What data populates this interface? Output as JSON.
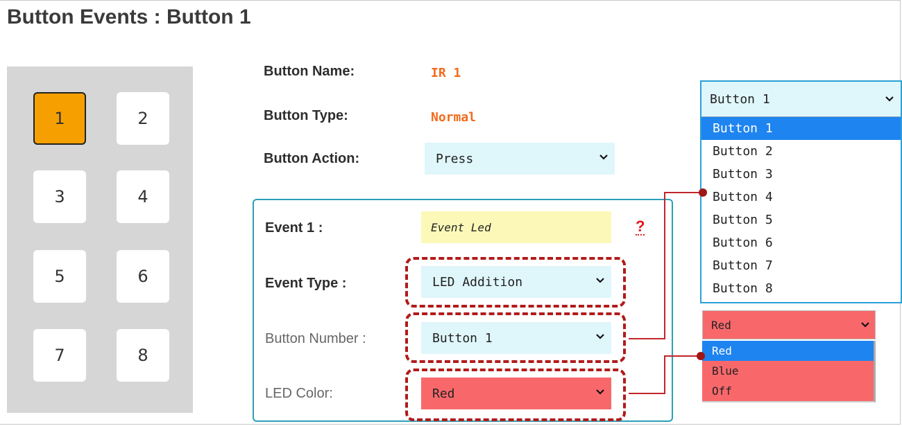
{
  "page_title": "Button Events : Button 1",
  "keypad": {
    "keys": [
      "1",
      "2",
      "3",
      "4",
      "5",
      "6",
      "7",
      "8"
    ],
    "active": "1"
  },
  "button_info": {
    "name_label": "Button Name:",
    "name_value": "IR 1",
    "type_label": "Button Type:",
    "type_value": "Normal",
    "action_label": "Button Action:",
    "action_value": "Press"
  },
  "event": {
    "label": "Event 1 :",
    "name_value": "Event Led",
    "help_text": "?",
    "type_label": "Event Type :",
    "type_value": "LED Addition",
    "button_number_label": "Button Number :",
    "button_number_value": "Button 1",
    "led_color_label": "LED Color:",
    "led_color_value": "Red"
  },
  "button_dropdown": {
    "selected": "Button 1",
    "options": [
      "Button 1",
      "Button 2",
      "Button 3",
      "Button 4",
      "Button 5",
      "Button 6",
      "Button 7",
      "Button 8"
    ]
  },
  "color_dropdown": {
    "selected": "Red",
    "options": [
      "Red",
      "Blue",
      "Off"
    ]
  },
  "colors": {
    "accent_orange": "#f26a1b",
    "active_key": "#f5a000",
    "select_bg": "#dff6fb",
    "red_select": "#f8686b",
    "highlight_blue": "#1e84f0",
    "dashed_outline": "#b11b1b",
    "event_border": "#2aa0b7",
    "event_name_bg": "#fcf9b8"
  }
}
